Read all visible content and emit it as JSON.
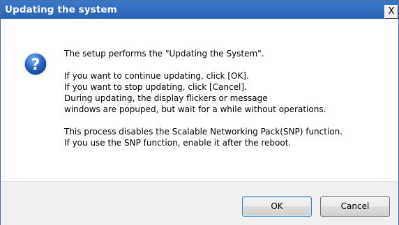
{
  "window": {
    "title": "Updating the system",
    "close_label": "X"
  },
  "icon": {
    "name": "question-icon",
    "glyph": "?",
    "color": "#2a69c4"
  },
  "message": {
    "line1": "The setup performs the \"Updating the System\".",
    "line2": "If you want to continue updating, click [OK].",
    "line3": "If you want to stop updating, click [Cancel].",
    "line4": "During updating, the display flickers or message",
    "line5": "windows are popuped, but wait for a while without operations.",
    "line6": "This process disables the Scalable Networking Pack(SNP) function.",
    "line7": "If you use the SNP function, enable it after the reboot."
  },
  "buttons": {
    "ok_label": "OK",
    "cancel_label": "Cancel"
  }
}
